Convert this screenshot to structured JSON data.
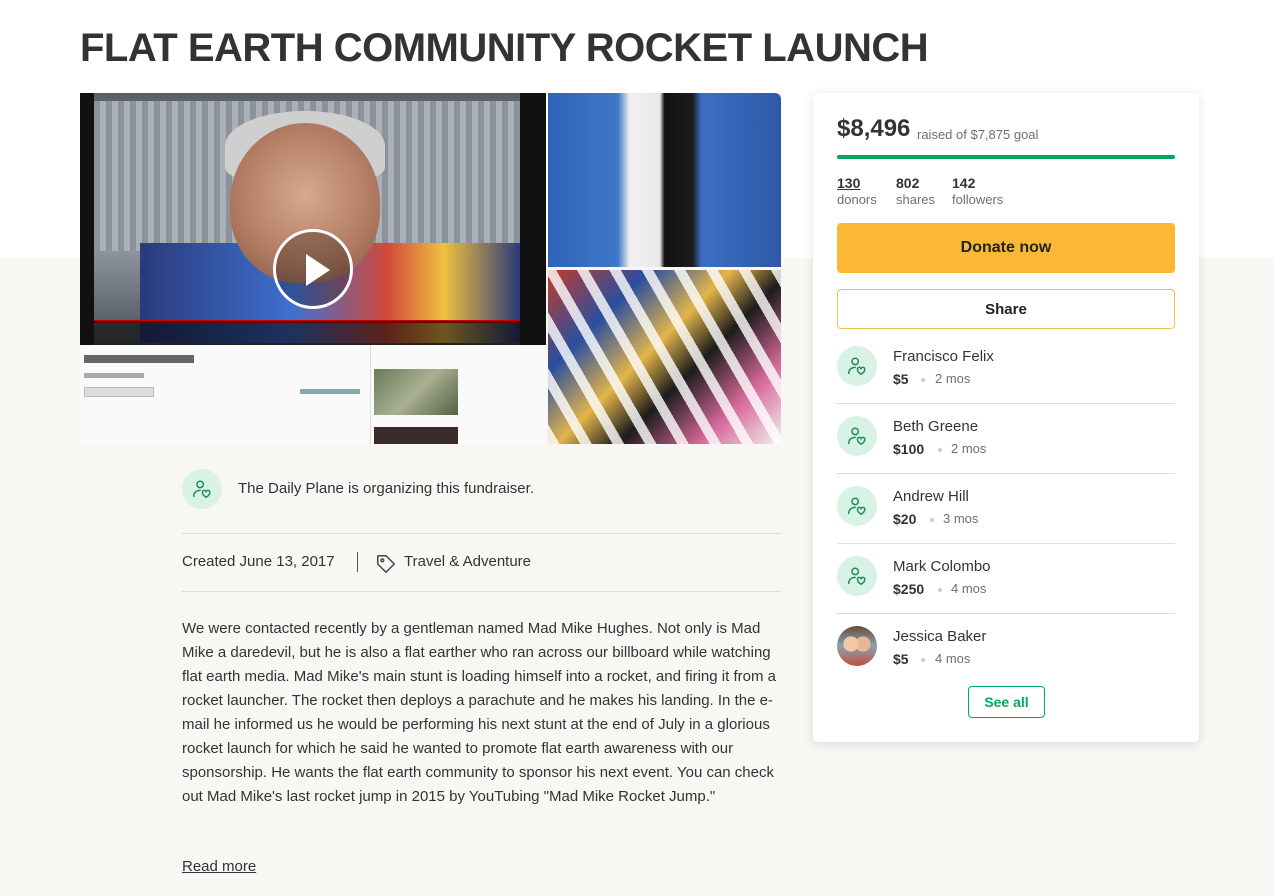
{
  "page": {
    "title": "FLAT EARTH COMMUNITY ROCKET LAUNCH"
  },
  "organizer": {
    "text": "The Daily Plane is organizing this fundraiser.",
    "icon": "heart-user-icon"
  },
  "meta": {
    "created": "Created June 13, 2017",
    "category": "Travel & Adventure",
    "category_icon": "tag-icon"
  },
  "story": {
    "text": "We were contacted recently by a gentleman named Mad Mike Hughes. Not only is Mad Mike a daredevil, but he is also a flat earther who ran across our billboard while watching flat earth media. Mad Mike's main stunt is loading himself into a rocket, and firing it from a rocket launcher. The rocket then deploys a parachute and he makes his landing. In the e-mail he informed us he would be performing his next stunt at the end of July in a glorious rocket launch for which he said he wanted to promote flat earth awareness with our sponsorship. He wants the flat earth community to sponsor his next event. You can check out Mad Mike's last rocket jump in 2015 by YouTubing \"Mad Mike Rocket Jump.\"",
    "read_more": "Read more"
  },
  "media": {
    "video_play_icon": "play-icon"
  },
  "donation": {
    "raised": "$8,496",
    "goal_text": "raised of $7,875 goal",
    "progress_fraction": 1.0,
    "accent_color": "#02a95c",
    "stats": [
      {
        "number": "130",
        "label": "donors"
      },
      {
        "number": "802",
        "label": "shares"
      },
      {
        "number": "142",
        "label": "followers"
      }
    ],
    "donate_label": "Donate now",
    "share_label": "Share",
    "donate_color": "#fbb835",
    "see_all_label": "See all"
  },
  "donors": [
    {
      "name": "Francisco Felix",
      "amount": "$5",
      "time": "2 mos"
    },
    {
      "name": "Beth Greene",
      "amount": "$100",
      "time": "2 mos"
    },
    {
      "name": "Andrew Hill",
      "amount": "$20",
      "time": "3 mos"
    },
    {
      "name": "Mark Colombo",
      "amount": "$250",
      "time": "4 mos"
    },
    {
      "name": "Jessica Baker",
      "amount": "$5",
      "time": "4 mos"
    }
  ]
}
